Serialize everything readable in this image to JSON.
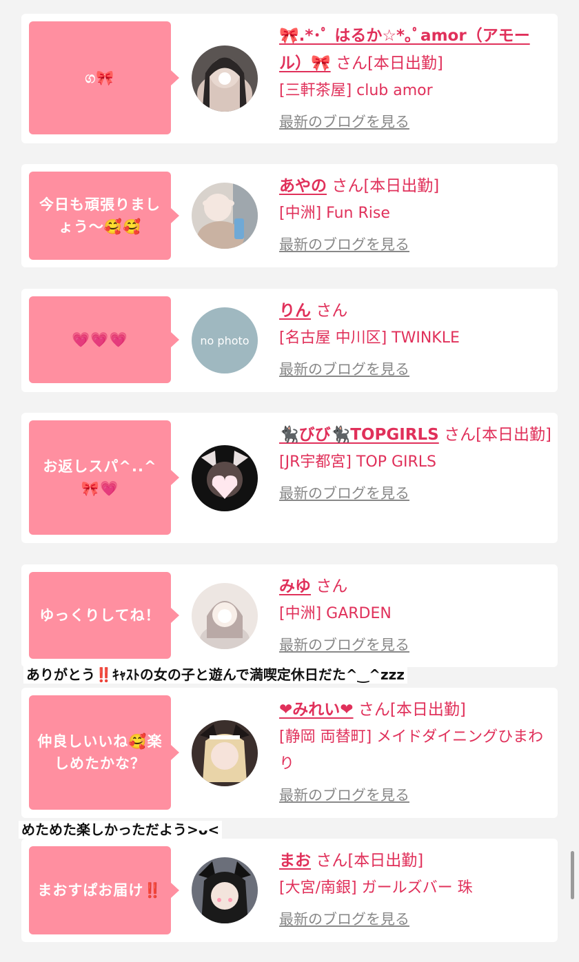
{
  "colors": {
    "accent": "#e0305a",
    "bubble": "#ff8fa0",
    "link_gray": "#888888"
  },
  "blog_link_label": "最新のブログを見る",
  "san_label": "さん",
  "entries": [
    {
      "bubble": "ග🎀",
      "name": "🎀.*･ﾟ はるか☆*｡ﾟamor（アモール）🎀",
      "status": "[本日出勤]",
      "shop": "[三軒茶屋] club amor"
    },
    {
      "bubble": "今日も頑張りましょう〜🥰🥰",
      "name": "あやの",
      "status": "[本日出勤]",
      "shop": "[中洲] Fun Rise"
    },
    {
      "bubble": "💗💗💗",
      "name": "りん",
      "status": "",
      "shop": "[名古屋 中川区] TWINKLE",
      "avatar_text": "no photo"
    },
    {
      "bubble": "お返しスパ^..^🎀💗",
      "name": "🐈‍⬛びび🐈‍⬛TOPGIRLS",
      "status": "[本日出勤]",
      "shop": "[JR宇都宮] TOP GIRLS"
    },
    {
      "bubble": "ゆっくりしてね！",
      "name": "みゆ",
      "status": "",
      "shop": "[中洲] GARDEN"
    },
    {
      "bubble": "仲良しいいね🥰楽しめたかな？",
      "name": "❤みれい❤",
      "status": "[本日出勤]",
      "shop": "[静岡 両替町] メイドダイニングひまわり"
    },
    {
      "bubble": "まおすぱお届け‼️",
      "name": "まお",
      "status": "[本日出勤]",
      "shop": "[大宮/南銀] ガールズバー 珠"
    }
  ],
  "comments": [
    "ありがとう‼️ｷｬｽﾄの女の子と遊んで満喫定休日だた^‿^zzz",
    "めためた楽しかっただよう>ᴗ<"
  ]
}
